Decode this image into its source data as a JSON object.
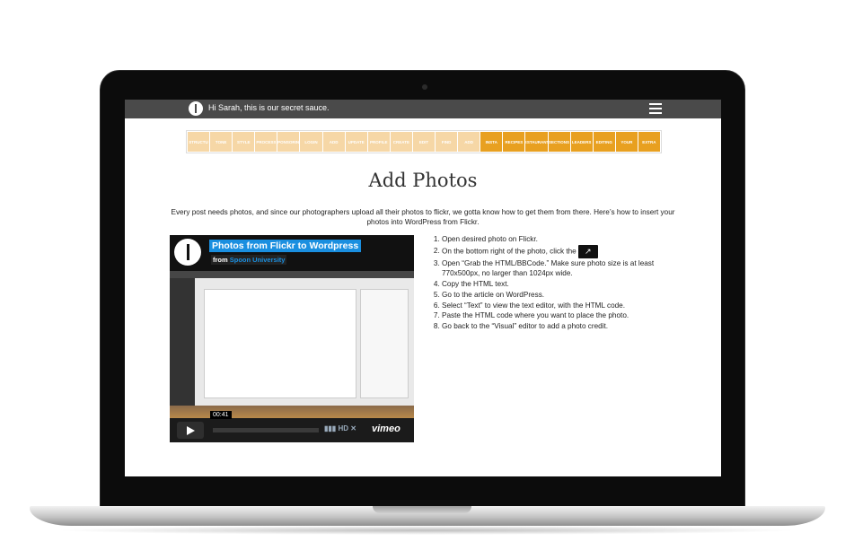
{
  "topbar": {
    "greeting": "Hi Sarah, this is our secret sauce."
  },
  "nav": {
    "items": [
      "STRUCTU",
      "TONE",
      "STYLE",
      "PROCESS",
      "SPONSORING",
      "LOGIN",
      "ADD",
      "UPDATE",
      "PROFILE",
      "CREATE",
      "EDIT",
      "FIND",
      "ADD",
      "INSTA",
      "RECIPES",
      "RESTAURANTS",
      "SECTIONS",
      "LEADERS",
      "EDITING",
      "YOUR",
      "EXTRA"
    ]
  },
  "page": {
    "title": "Add Photos",
    "intro": "Every post needs photos, and since our photographers upload all their photos to flickr, we gotta know how to get them from there. Here’s how to insert your photos into WordPress from Flickr."
  },
  "video": {
    "title": "Photos from Flickr to Wordpress",
    "from_prefix": "from",
    "from_name": "Spoon University",
    "time": "00:41",
    "controls_hd": "HD",
    "brand": "vimeo"
  },
  "steps": [
    "Open desired photo on Flickr.",
    "On the bottom right of the photo, click the",
    "Open “Grab the HTML/BBCode.” Make sure photo size is at least 770x500px, no larger than 1024px wide.",
    "Copy the HTML text.",
    "Go to the article on WordPress.",
    "Select “Text” to view the text editor, with the HTML code.",
    "Paste the HTML code where you want to place the photo.",
    "Go back to the “Visual” editor to add a photo credit."
  ]
}
